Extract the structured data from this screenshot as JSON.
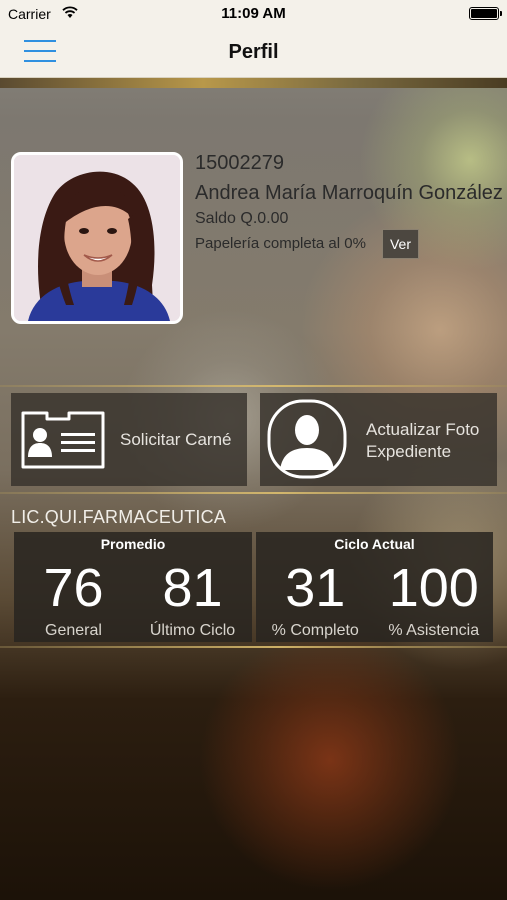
{
  "status_bar": {
    "carrier": "Carrier",
    "time": "11:09 AM"
  },
  "nav": {
    "title": "Perfil"
  },
  "profile": {
    "id": "15002279",
    "name": "Andrea María Marroquín González",
    "saldo": "Saldo Q.0.00",
    "papeleria": "Papelería completa al 0%",
    "ver_label": "Ver"
  },
  "actions": {
    "solicitar": "Solicitar Carné",
    "actualizar_line1": "Actualizar Foto",
    "actualizar_line2": "Expediente"
  },
  "career": "LIC.QUI.FARMACEUTICA",
  "stats": {
    "promedio": {
      "title": "Promedio",
      "general_value": "76",
      "general_label": "General",
      "ultimo_value": "81",
      "ultimo_label": "Último Ciclo"
    },
    "ciclo": {
      "title": "Ciclo Actual",
      "completo_value": "31",
      "completo_label": "% Completo",
      "asistencia_value": "100",
      "asistencia_label": "% Asistencia"
    }
  },
  "colors": {
    "menu_accent": "#2f90e0",
    "nav_bg": "#f4f1ea"
  },
  "icons": [
    "wifi-icon",
    "battery-icon",
    "hamburger-menu-icon",
    "id-card-icon",
    "person-silhouette-icon"
  ]
}
